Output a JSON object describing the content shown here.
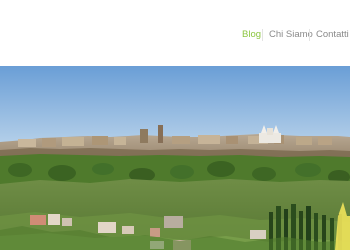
{
  "nav": {
    "items": [
      {
        "label": "Blog",
        "active": true
      },
      {
        "label": "Chi Siamo",
        "active": false
      },
      {
        "label": "Contatti e",
        "active": false
      }
    ]
  },
  "colors": {
    "accent": "#8cc63f",
    "nav_text": "#8a8a8a",
    "sky_top": "#6a9ed6",
    "sky_bottom": "#b8d2ea",
    "foliage": "#4f7a2c"
  },
  "hero": {
    "icon": "panorama-landscape-photo"
  }
}
